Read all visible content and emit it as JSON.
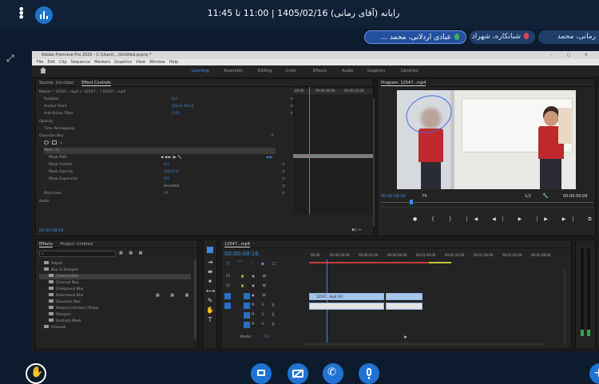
{
  "header": {
    "meeting_title": "رایانه (آقای رمانی) 1405/02/16 | 11:00 تا 11:45"
  },
  "participants": [
    {
      "name": "عبادی اردلانی، محمد ...",
      "state": "speaking",
      "mic_color": "#3fae58"
    },
    {
      "name": "شبانکاره، شهراد",
      "state": "muted",
      "mic_color": "#d84a4a"
    },
    {
      "name": "رمانی، محمد",
      "state": "muted",
      "mic_color": "#d84a4a"
    }
  ],
  "app": {
    "window_title": "Adobe Premiere Pro 2020 - C:\\Users\\...\\Untitled.prproj *",
    "menu": [
      "File",
      "Edit",
      "Clip",
      "Sequence",
      "Markers",
      "Graphics",
      "View",
      "Window",
      "Help"
    ],
    "workspaces": [
      "Learning",
      "Assembly",
      "Editing",
      "Color",
      "Effects",
      "Audio",
      "Graphics",
      "Libraries"
    ],
    "active_workspace": "Learning",
    "effect_controls": {
      "tabs": [
        "Source: (no clips)",
        "Effect Controls"
      ],
      "master": "Master * 12547...mp4  >  12547... * 12547...mp4",
      "timecodes": [
        "00:00",
        "00:00:16:00",
        "00:00:32:00"
      ],
      "rows": [
        {
          "label": "Rotation",
          "value": "0.0"
        },
        {
          "label": "Anchor Point",
          "value": "654.0   360.0"
        },
        {
          "label": "Anti-flicker Filter",
          "value": "0.00"
        },
        {
          "label": "Opacity",
          "value": ""
        },
        {
          "label": "Time Remapping",
          "value": ""
        },
        {
          "label": "Gaussian Blur",
          "value": ""
        },
        {
          "label": "",
          "value": ""
        },
        {
          "label": "Mask (1)",
          "value": ""
        },
        {
          "label": "Mask Path",
          "value": ""
        },
        {
          "label": "Mask Feather",
          "value": "4.0"
        },
        {
          "label": "Mask Opacity",
          "value": "100.0 %"
        },
        {
          "label": "Mask Expansion",
          "value": "0.0"
        },
        {
          "label": "",
          "value": "Inverted"
        },
        {
          "label": "Blurriness",
          "value": "24"
        },
        {
          "label": "Audio",
          "value": ""
        }
      ],
      "current_time": "00:00:08:16"
    },
    "program": {
      "tab": "Program: 12547...mp4",
      "timecode": "00:00:08:16",
      "fit": "Fit",
      "quality": "1/2",
      "duration": "00:00:50:09"
    },
    "effects": {
      "tabs": [
        "Effects",
        "Project: Untitled"
      ],
      "items": [
        {
          "label": "Adjust",
          "sel": false
        },
        {
          "label": "Blur & Sharpen",
          "sel": false
        },
        {
          "label": "Camera Blur",
          "sel": true
        },
        {
          "label": "Channel Blur",
          "sel": false
        },
        {
          "label": "Compound Blur",
          "sel": false
        },
        {
          "label": "Directional Blur",
          "sel": false
        },
        {
          "label": "Gaussian Blur",
          "sel": false
        },
        {
          "label": "Reduce Interlace Flicker",
          "sel": false
        },
        {
          "label": "Sharpen",
          "sel": false
        },
        {
          "label": "Unsharp Mask",
          "sel": false
        },
        {
          "label": "Channel",
          "sel": false
        }
      ]
    },
    "timeline": {
      "tab": "12547...mp4",
      "timecode": "00:00:08:16",
      "ruler": [
        "00:00",
        "00:00:16:00",
        "00:00:32:00",
        "00:00:48:00",
        "00:01:04:00",
        "00:01:20:00",
        "00:01:36:00",
        "00:01:52:00",
        "00:02:08:00"
      ],
      "tracks": [
        "V3",
        "V2",
        "V1",
        "A1",
        "A2",
        "A3",
        "Master"
      ],
      "video_clip": "12547...mp4 [V]",
      "master_value": "0.0"
    }
  },
  "controls": {
    "colors": {
      "accent": "#1f73d3",
      "bg": "#0d1b2e"
    }
  }
}
